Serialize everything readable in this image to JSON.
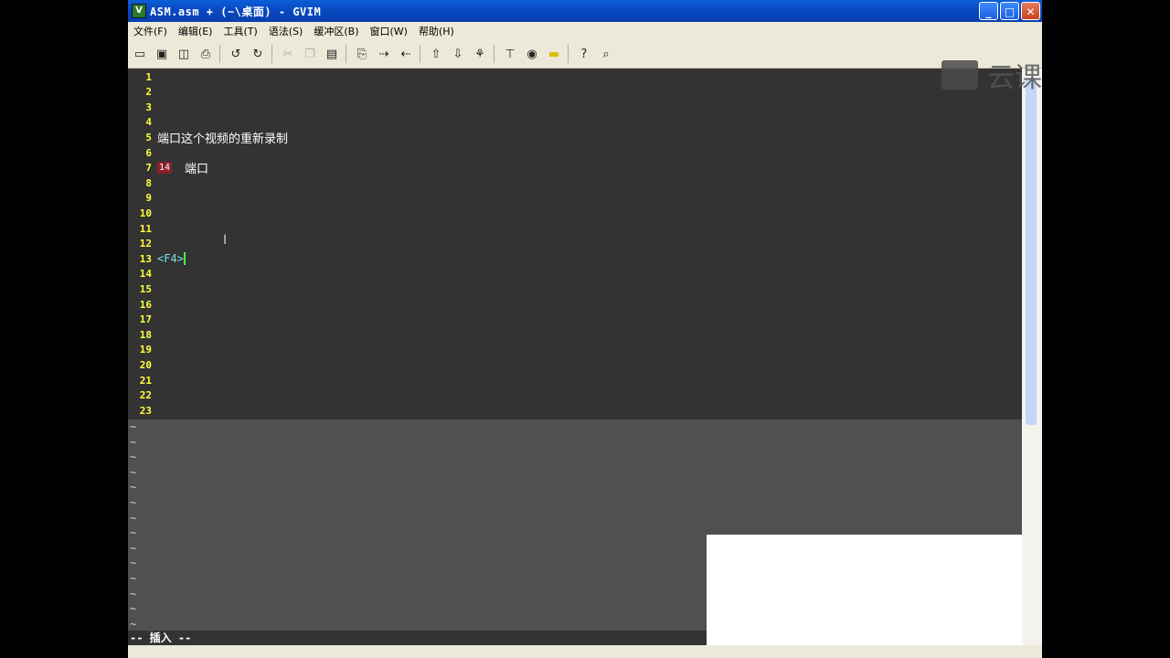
{
  "window": {
    "title": "ASM.asm + (~\\桌面) - GVIM",
    "controls": [
      "minimize",
      "maximize",
      "close"
    ]
  },
  "menu": [
    "文件(F)",
    "编辑(E)",
    "工具(T)",
    "语法(S)",
    "缓冲区(B)",
    "窗口(W)",
    "帮助(H)"
  ],
  "toolbar": {
    "groups": [
      [
        "open-icon",
        "save-icon",
        "save-all-icon",
        "print-icon"
      ],
      [
        "undo-icon",
        "redo-icon"
      ],
      [
        "cut-icon",
        "copy-icon",
        "paste-icon"
      ],
      [
        "find-replace-icon",
        "find-next-icon",
        "find-prev-icon"
      ],
      [
        "load-session-icon",
        "save-session-icon",
        "run-script-icon"
      ],
      [
        "make-icon",
        "run-ctags-icon",
        "jump-tag-icon"
      ],
      [
        "help-icon",
        "find-help-icon"
      ]
    ]
  },
  "editor": {
    "lines": [
      {
        "num": "1",
        "text": ""
      },
      {
        "num": "2",
        "text": ""
      },
      {
        "num": "3",
        "text": ""
      },
      {
        "num": "4",
        "text": ""
      },
      {
        "num": "5",
        "text": "端口这个视频的重新录制"
      },
      {
        "num": "6",
        "text": ""
      },
      {
        "num": "7",
        "badge": "14",
        "text": "端口"
      },
      {
        "num": "8",
        "text": ""
      },
      {
        "num": "9",
        "text": ""
      },
      {
        "num": "10",
        "text": ""
      },
      {
        "num": "11",
        "text": ""
      },
      {
        "num": "12",
        "text": ""
      },
      {
        "num": "13",
        "key": "<F4>",
        "text": ""
      },
      {
        "num": "14",
        "text": ""
      },
      {
        "num": "15",
        "text": ""
      },
      {
        "num": "16",
        "text": ""
      },
      {
        "num": "17",
        "text": ""
      },
      {
        "num": "18",
        "text": ""
      },
      {
        "num": "19",
        "text": ""
      },
      {
        "num": "20",
        "text": ""
      },
      {
        "num": "21",
        "text": ""
      },
      {
        "num": "22",
        "text": ""
      },
      {
        "num": "23",
        "text": ""
      }
    ],
    "tilde": "~",
    "tilde_count": 14
  },
  "status": {
    "mode": "-- 插入 --"
  },
  "watermark": "云课",
  "colors": {
    "editor_bg": "#333333",
    "line_number": "#ffff40",
    "text": "#ffffff",
    "key_color": "#7fe0e0",
    "cursor": "#40ff40"
  }
}
